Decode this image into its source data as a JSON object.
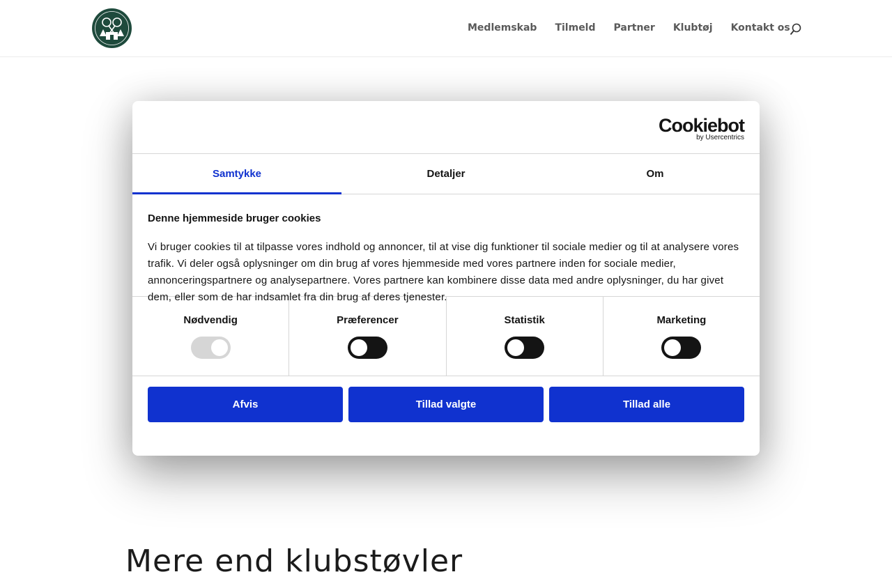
{
  "header": {
    "nav": [
      "Medlemskab",
      "Tilmeld",
      "Partner",
      "Klubtøj",
      "Kontakt os"
    ]
  },
  "background": {
    "heading": "Mere end klubstøvler"
  },
  "cookie_dialog": {
    "brand": {
      "name": "Cookiebot",
      "sub": "by Usercentrics"
    },
    "tabs": [
      "Samtykke",
      "Detaljer",
      "Om"
    ],
    "active_tab": "Samtykke",
    "title": "Denne hjemmeside bruger cookies",
    "text": "Vi bruger cookies til at tilpasse vores indhold og annoncer, til at vise dig funktioner til sociale medier og til at analysere vores trafik. Vi deler også oplysninger om din brug af vores hjemmeside med vores partnere inden for sociale medier, annonceringspartnere og analysepartnere. Vores partnere kan kombinere disse data med andre oplysninger, du har givet dem, eller som de har indsamlet fra din brug af deres tjenester.",
    "categories": [
      {
        "label": "Nødvendig",
        "state": "on-disabled"
      },
      {
        "label": "Præferencer",
        "state": "off"
      },
      {
        "label": "Statistik",
        "state": "off"
      },
      {
        "label": "Marketing",
        "state": "off"
      }
    ],
    "buttons": [
      "Afvis",
      "Tillad valgte",
      "Tillad alle"
    ]
  },
  "colors": {
    "accent": "#1032cf",
    "toggle_off": "#141414",
    "toggle_disabled": "#d6d6d6",
    "logo": "#1e4a3c"
  }
}
